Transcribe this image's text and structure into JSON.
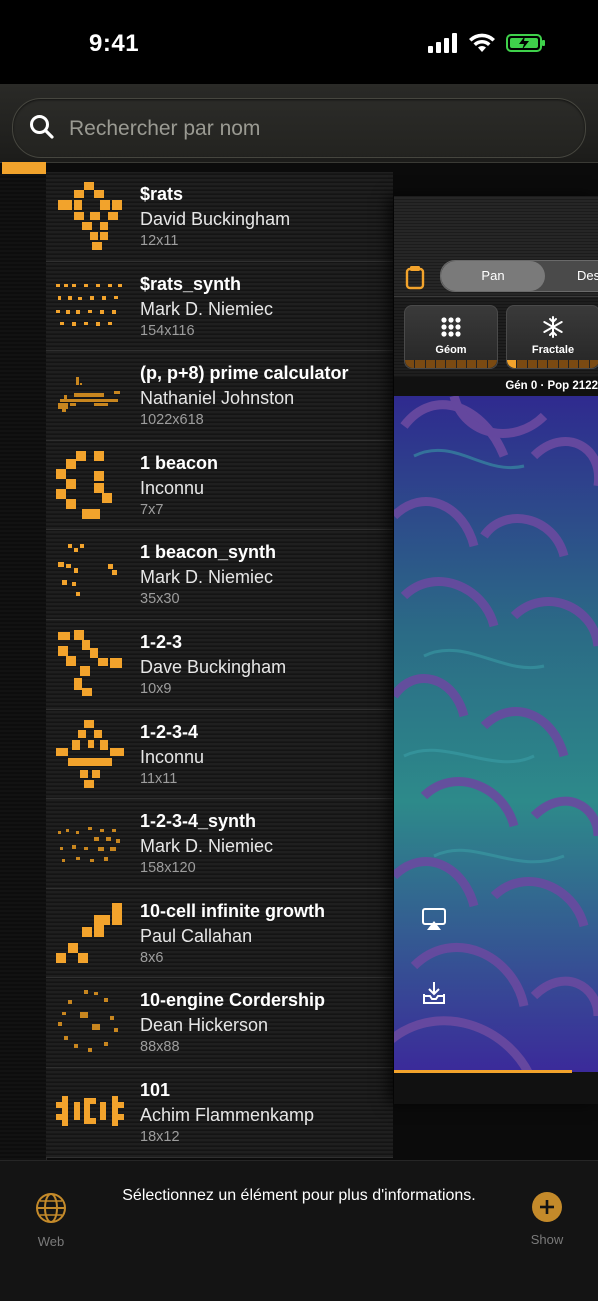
{
  "status": {
    "time": "9:41"
  },
  "search": {
    "placeholder": "Rechercher par nom"
  },
  "items": [
    {
      "name": "$rats",
      "author": "David Buckingham",
      "size": "12x11"
    },
    {
      "name": "$rats_synth",
      "author": "Mark D. Niemiec",
      "size": "154x116"
    },
    {
      "name": "(p, p+8) prime calculator",
      "author": "Nathaniel Johnston",
      "size": "1022x618"
    },
    {
      "name": "1 beacon",
      "author": "Inconnu",
      "size": "7x7"
    },
    {
      "name": "1 beacon_synth",
      "author": "Mark D. Niemiec",
      "size": "35x30"
    },
    {
      "name": "1-2-3",
      "author": "Dave Buckingham",
      "size": "10x9"
    },
    {
      "name": "1-2-3-4",
      "author": "Inconnu",
      "size": "11x11"
    },
    {
      "name": "1-2-3-4_synth",
      "author": "Mark D. Niemiec",
      "size": "158x120"
    },
    {
      "name": "10-cell infinite growth",
      "author": "Paul Callahan",
      "size": "8x6"
    },
    {
      "name": "10-engine Cordership",
      "author": "Dean Hickerson",
      "size": "88x88"
    },
    {
      "name": "101",
      "author": "Achim Flammenkamp",
      "size": "18x12"
    }
  ],
  "detail": {
    "segment_pan": "Pan",
    "segment_des": "Des",
    "tool_geom": "Géom",
    "tool_fractale": "Fractale",
    "gen_label": "Gén 0 · Pop 2122"
  },
  "bottom": {
    "web_label": "Web",
    "info": "Sélectionnez un élément pour plus d'informations.",
    "show_label": "Show"
  },
  "colors": {
    "accent": "#f2a32c"
  }
}
